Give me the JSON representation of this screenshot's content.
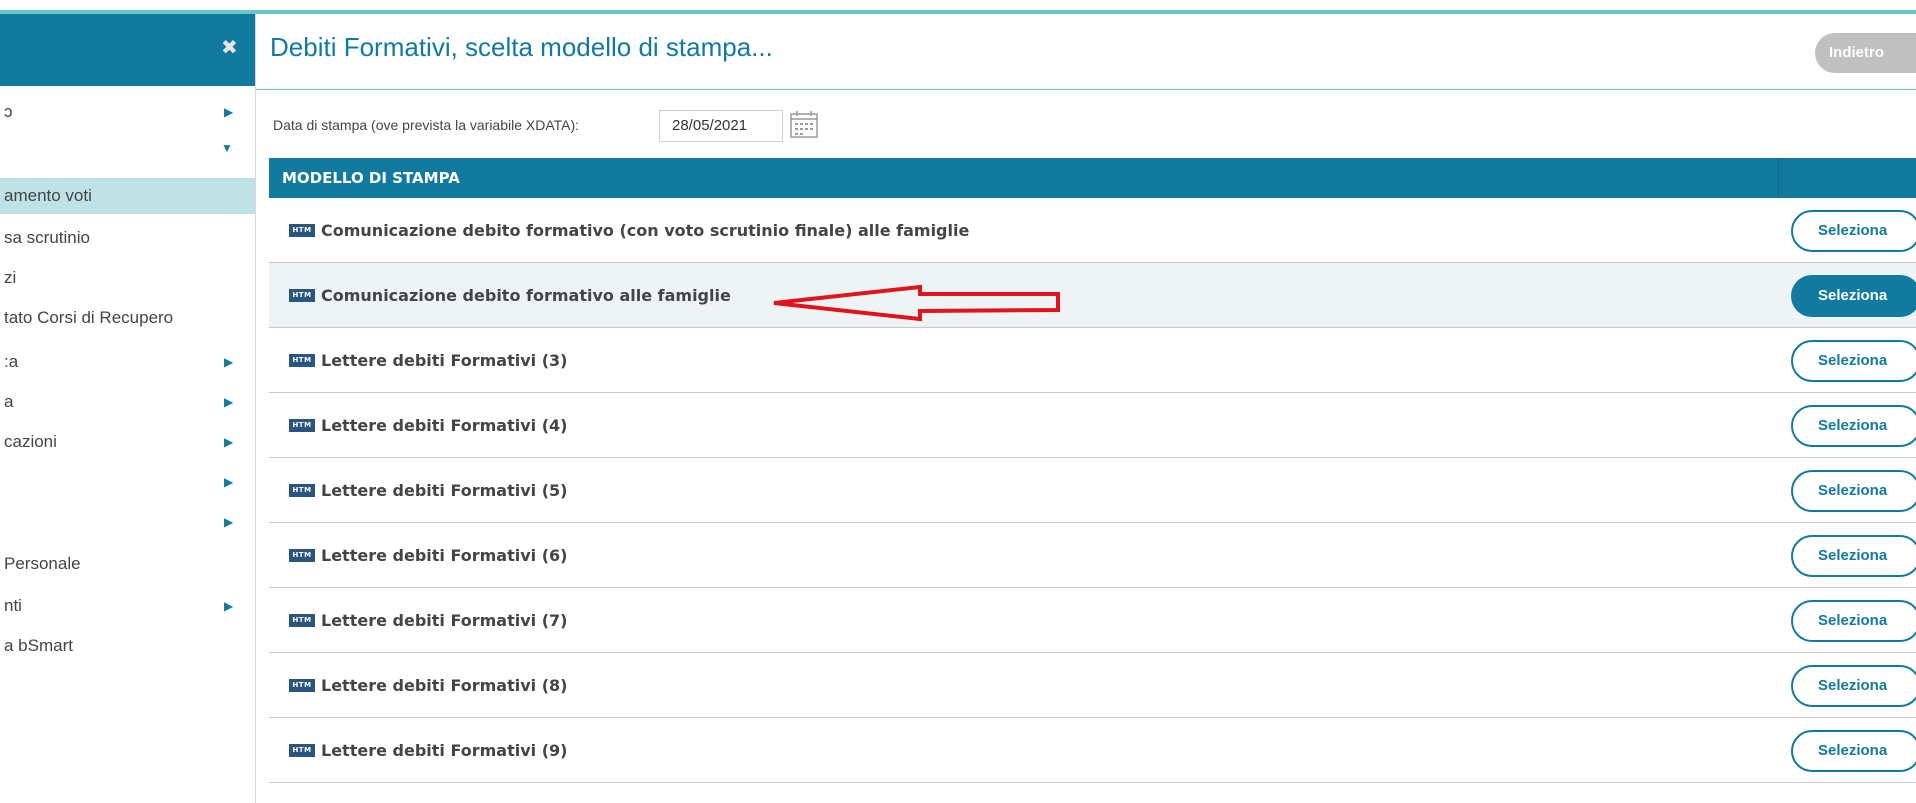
{
  "sidebar": {
    "close_icon_glyph": "✖",
    "items": [
      {
        "label": "ɔ",
        "arrow": "right"
      },
      {
        "label": "",
        "arrow": "down"
      },
      {
        "label": "amento voti",
        "active": true
      },
      {
        "label": "sa scrutinio"
      },
      {
        "label": "zi"
      },
      {
        "label": "tato Corsi di Recupero"
      },
      {
        "label": ":a",
        "arrow": "right"
      },
      {
        "label": "a",
        "arrow": "right"
      },
      {
        "label": "cazioni",
        "arrow": "right"
      },
      {
        "label": "",
        "arrow": "right"
      },
      {
        "label": "",
        "arrow": "right"
      },
      {
        "label": "Personale"
      },
      {
        "label": "nti",
        "arrow": "right"
      },
      {
        "label": "a bSmart"
      }
    ]
  },
  "header": {
    "title": "Debiti Formativi, scelta modello di stampa...",
    "back_label": "Indietro"
  },
  "print_date": {
    "label": "Data di stampa (ove prevista la variabile XDATA):",
    "value": "28/05/2021"
  },
  "table": {
    "header": "MODELLO DI STAMPA",
    "badge": "HTM",
    "select_label": "Seleziona",
    "rows": [
      {
        "label": "Comunicazione debito formativo (con voto scrutinio finale) alle famiglie"
      },
      {
        "label": "Comunicazione debito formativo alle famiglie",
        "highlighted": true
      },
      {
        "label": "Lettere debiti Formativi (3)"
      },
      {
        "label": "Lettere debiti Formativi (4)"
      },
      {
        "label": "Lettere debiti Formativi (5)"
      },
      {
        "label": "Lettere debiti Formativi (6)"
      },
      {
        "label": "Lettere debiti Formativi (7)"
      },
      {
        "label": "Lettere debiti Formativi (8)"
      },
      {
        "label": "Lettere debiti Formativi (9)"
      }
    ]
  },
  "colors": {
    "accent": "#127a9e",
    "sidebar_active": "#bfe2e6",
    "arrow_annotation": "#e0141c"
  }
}
